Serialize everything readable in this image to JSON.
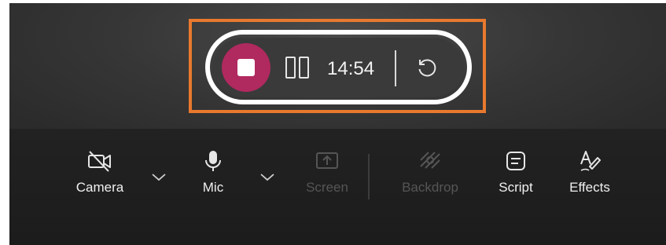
{
  "recording_bar": {
    "timer": "14:54",
    "stop_icon": "stop-square",
    "pause_icon": "pause-bars",
    "retake_icon": "rotate-ccw",
    "colors": {
      "stop_button": "#b0295f",
      "highlight": "#e8792e",
      "pill_border": "#ffffff"
    }
  },
  "toolbar": {
    "camera": {
      "label": "Camera",
      "icon": "camera-off",
      "enabled": true
    },
    "mic": {
      "label": "Mic",
      "icon": "microphone",
      "enabled": true
    },
    "screen": {
      "label": "Screen",
      "icon": "screen-share",
      "enabled": false
    },
    "backdrop": {
      "label": "Backdrop",
      "icon": "backdrop",
      "enabled": false
    },
    "script": {
      "label": "Script",
      "icon": "script-note",
      "enabled": true
    },
    "effects": {
      "label": "Effects",
      "icon": "pen-effects",
      "enabled": true
    },
    "dropdown_icon": "chevron-down"
  }
}
